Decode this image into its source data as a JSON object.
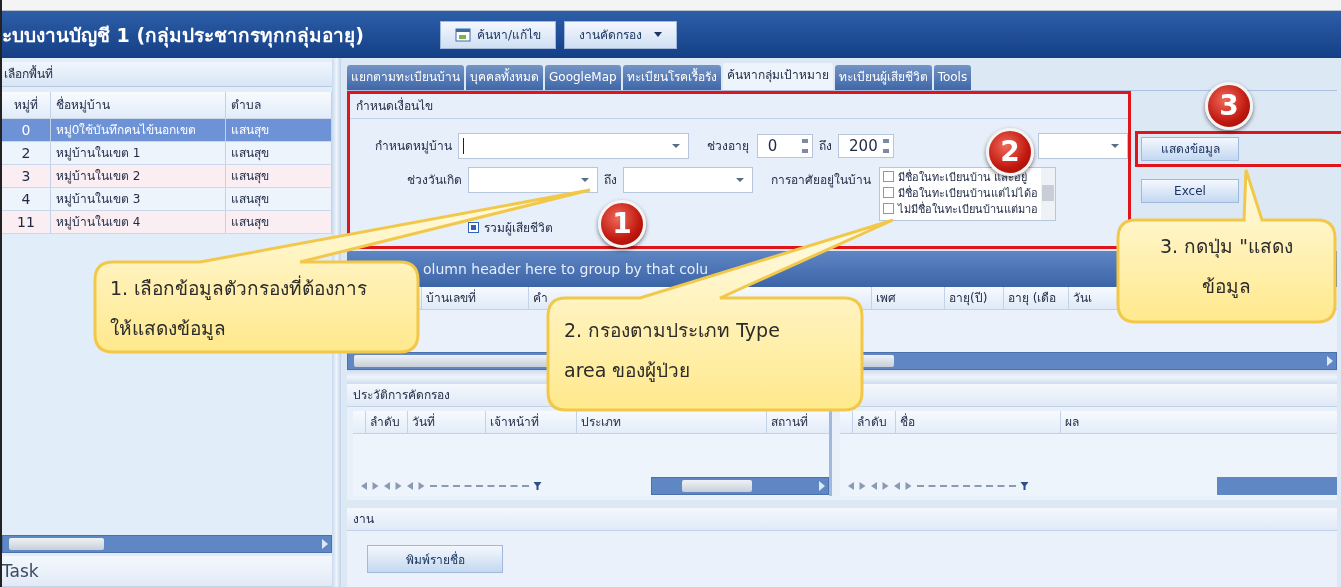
{
  "window": {
    "title": "ะบบงานบัญชี 1 (กลุ่มประชากรทุกกลุ่มอายุ)",
    "buttons": [
      {
        "label": "ค้นหา/แก้ไข",
        "kind": "icon"
      },
      {
        "label": "งานคัดกรอง",
        "kind": "dropdown"
      }
    ]
  },
  "area_panel": {
    "title": "เลือกพื้นที่",
    "columns": [
      "หมู่ที่",
      "ชื่อหมู่บ้าน",
      "ตำบล"
    ],
    "rows": [
      {
        "cells": [
          "0",
          "หมู่0ใช้บันทึกคนไข้นอกเขต",
          "แสนสุข"
        ],
        "selected": true
      },
      {
        "cells": [
          "2",
          "หมู่บ้านในเขต 1",
          "แสนสุข"
        ],
        "selected": false
      },
      {
        "cells": [
          "3",
          "หมู่บ้านในเขต 2",
          "แสนสุข"
        ],
        "selected": false
      },
      {
        "cells": [
          "4",
          "หมู่บ้านในเขต 3",
          "แสนสุข"
        ],
        "selected": false
      },
      {
        "cells": [
          "11",
          "หมู่บ้านในเขต 4",
          "แสนสุข"
        ],
        "selected": false
      }
    ],
    "task_label": "Task"
  },
  "tabs": [
    {
      "label": "แยกตามทะเบียนบ้าน",
      "selected": false
    },
    {
      "label": "บุคคลทั้งหมด",
      "selected": false
    },
    {
      "label": "GoogleMap",
      "selected": false
    },
    {
      "label": "ทะเบียนโรคเรื้อรัง",
      "selected": false
    },
    {
      "label": "ค้นหากลุ่มเป้าหมาย",
      "selected": true
    },
    {
      "label": "ทะเบียนผู้เสียชีวิต",
      "selected": false
    },
    {
      "label": "Tools",
      "selected": false
    }
  ],
  "conditions": {
    "title": "กำหนดเงื่อนไข",
    "village_label": "กำหนดหมู่บ้าน",
    "age_label": "ช่วงอายุ",
    "age_from": "0",
    "age_to_label": "ถึง",
    "age_to": "200",
    "birth_label": "ช่วงวันเกิด",
    "birth_to_label": "ถึง",
    "residence_label": "การอาศัยอยู่ในบ้าน",
    "residence_options": [
      {
        "label": "มีชื่อในทะเบียนบ้าน และอยู่",
        "checked": false
      },
      {
        "label": "มีชื่อในทะเบียนบ้านแต่ไม่ได้อ",
        "checked": false
      },
      {
        "label": "ไม่มีชื่อในทะเบียนบ้านแต่มาอ",
        "checked": false
      }
    ],
    "include_deceased": {
      "label": "รวมผู้เสียชีวิต",
      "checked": true
    }
  },
  "actions": [
    {
      "label": "แสดงข้อมูล",
      "highlighted": true
    },
    {
      "label": "Excel",
      "highlighted": false
    }
  ],
  "result_grid": {
    "group_hint": "olumn header here to group by that colu",
    "columns": [
      "บ้านเลขที่",
      "คำ",
      "เพศ",
      "อายุ(ปี)",
      "อายุ (เดือ",
      "วันเ"
    ]
  },
  "history": {
    "title": "ประวัติการคัดกรอง",
    "columns": [
      "ลำดับ",
      "วันที่",
      "เจ้าหน้าที่",
      "ประเภท",
      "สถานที่"
    ],
    "detail_columns": [
      "ลำดับ",
      "ชื่อ",
      "ผล"
    ]
  },
  "tasks": {
    "title": "งาน",
    "button": "พิมพ์รายชื่อ"
  },
  "callouts": [
    {
      "badge": "1",
      "lines": [
        "1. เลือกข้อมูลตัวกรองที่ต้องการ",
        "ให้แสดงข้อมูล"
      ]
    },
    {
      "badge": "2",
      "lines": [
        "2. กรองตามประเภท Type",
        "area ของผู้ป่วย"
      ]
    },
    {
      "badge": "3",
      "lines": [
        "3. กดปุ่ม \"แสดง",
        "ข้อมูล"
      ]
    }
  ]
}
